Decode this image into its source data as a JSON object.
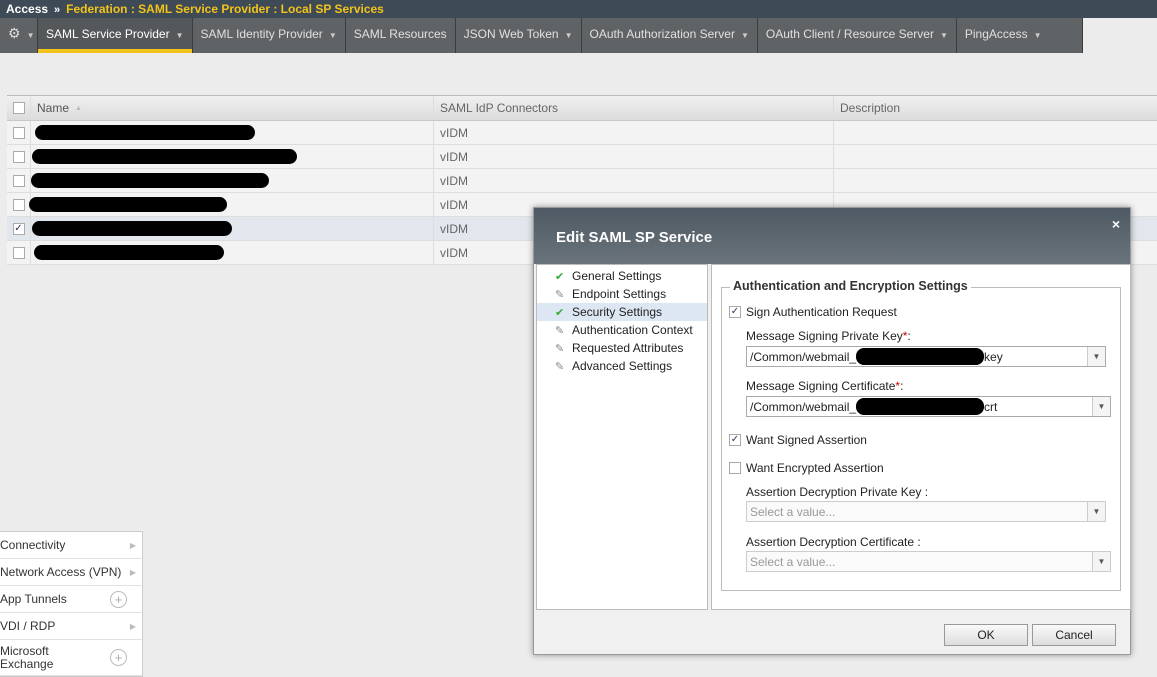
{
  "breadcrumb": {
    "root": "Access",
    "sep": "»",
    "path": "Federation : SAML Service Provider : Local SP Services"
  },
  "tabs": [
    {
      "label": "SAML Service Provider",
      "dropdown": true,
      "active": true
    },
    {
      "label": "SAML Identity Provider",
      "dropdown": true
    },
    {
      "label": "SAML Resources",
      "dropdown": false
    },
    {
      "label": "JSON Web Token",
      "dropdown": true
    },
    {
      "label": "OAuth Authorization Server",
      "dropdown": true
    },
    {
      "label": "OAuth Client / Resource Server",
      "dropdown": true
    },
    {
      "label": "PingAccess",
      "dropdown": true
    }
  ],
  "table": {
    "headers": [
      "Name",
      "SAML IdP Connectors",
      "Description"
    ],
    "sort_glyph": "▲",
    "rows": [
      {
        "connector": "vIDM",
        "checked": false
      },
      {
        "connector": "vIDM",
        "checked": false
      },
      {
        "connector": "vIDM",
        "checked": false
      },
      {
        "connector": "vIDM",
        "checked": false
      },
      {
        "connector": "vIDM",
        "checked": true
      },
      {
        "connector": "vIDM",
        "checked": false
      }
    ]
  },
  "menu": [
    {
      "label": "Connectivity",
      "type": "arrow"
    },
    {
      "label": "Network Access (VPN)",
      "type": "arrow"
    },
    {
      "label": "App Tunnels",
      "type": "plus"
    },
    {
      "label": "VDI / RDP",
      "type": "arrow"
    },
    {
      "label": "Microsoft Exchange",
      "type": "plus"
    }
  ],
  "dialog": {
    "title": "Edit SAML SP Service",
    "close": "×",
    "nav": [
      {
        "label": "General Settings",
        "done": true
      },
      {
        "label": "Endpoint Settings",
        "done": false
      },
      {
        "label": "Security Settings",
        "done": true,
        "selected": true
      },
      {
        "label": "Authentication Context",
        "done": false
      },
      {
        "label": "Requested Attributes",
        "done": false
      },
      {
        "label": "Advanced Settings",
        "done": false
      }
    ],
    "section": "Authentication and Encryption Settings",
    "sign_request": "Sign Authentication Request",
    "signing_key_label": "Message Signing Private Key",
    "signing_key_prefix": "/Common/webmail_",
    "signing_key_suffix": "key",
    "signing_cert_label": "Message Signing Certificate",
    "signing_cert_prefix": "/Common/webmail_",
    "signing_cert_suffix": "crt",
    "required": "*",
    "colon": ":",
    "want_signed": "Want Signed Assertion",
    "want_encrypted": "Want Encrypted Assertion",
    "decrypt_key_label": "Assertion Decryption Private Key  :",
    "decrypt_cert_label": "Assertion Decryption Certificate  :",
    "select_placeholder": "Select a value...",
    "ok": "OK",
    "cancel": "Cancel"
  }
}
